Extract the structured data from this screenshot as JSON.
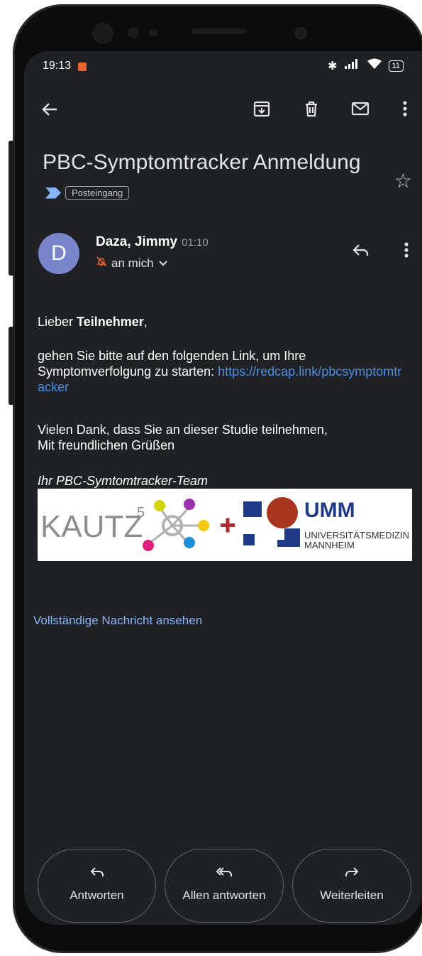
{
  "status_bar": {
    "time": "19:13",
    "battery": "11"
  },
  "toolbar": {
    "back_icon": "arrow-left-icon",
    "archive_icon": "archive-icon",
    "delete_icon": "trash-icon",
    "mark_unread_icon": "mail-icon",
    "more_icon": "more-vert-icon"
  },
  "email": {
    "subject": "PBC-Symptomtracker Anmeldung",
    "label": "Posteingang",
    "sender_initial": "D",
    "sender_name": "Daza, Jimmy",
    "time": "01:10",
    "recipient": "an mich",
    "body": {
      "greeting_prefix": "Lieber ",
      "greeting_bold": "Teilnehmer",
      "greeting_suffix": ",",
      "paragraph1": "gehen Sie bitte auf den folgenden Link, um Ihre Symptomverfolgung zu starten: ",
      "link": "https://redcap.link/pbcsymptomtracker",
      "paragraph2_line1": "Vielen Dank, dass Sie an dieser Studie teilnehmen,",
      "paragraph2_line2": "Mit freundlichen Grüßen",
      "signature": "Ihr PBC-Symtomtracker-Team"
    },
    "logo": {
      "left_text": "KAUTZ",
      "left_superscript": "5",
      "right_title": "UMM",
      "right_line1": "UNIVERSITÄTSMEDIZIN",
      "right_line2": "MANNHEIM"
    },
    "view_full": "Vollständige Nachricht ansehen"
  },
  "actions": {
    "reply": "Antworten",
    "reply_all": "Allen antworten",
    "forward": "Weiterleiten"
  },
  "colors": {
    "background": "#202124",
    "link": "#4a8fe8",
    "avatar": "#7986cb",
    "label_flag": "#8ab4f8",
    "umm_red": "#a8341e",
    "umm_blue": "#1f3b87"
  }
}
